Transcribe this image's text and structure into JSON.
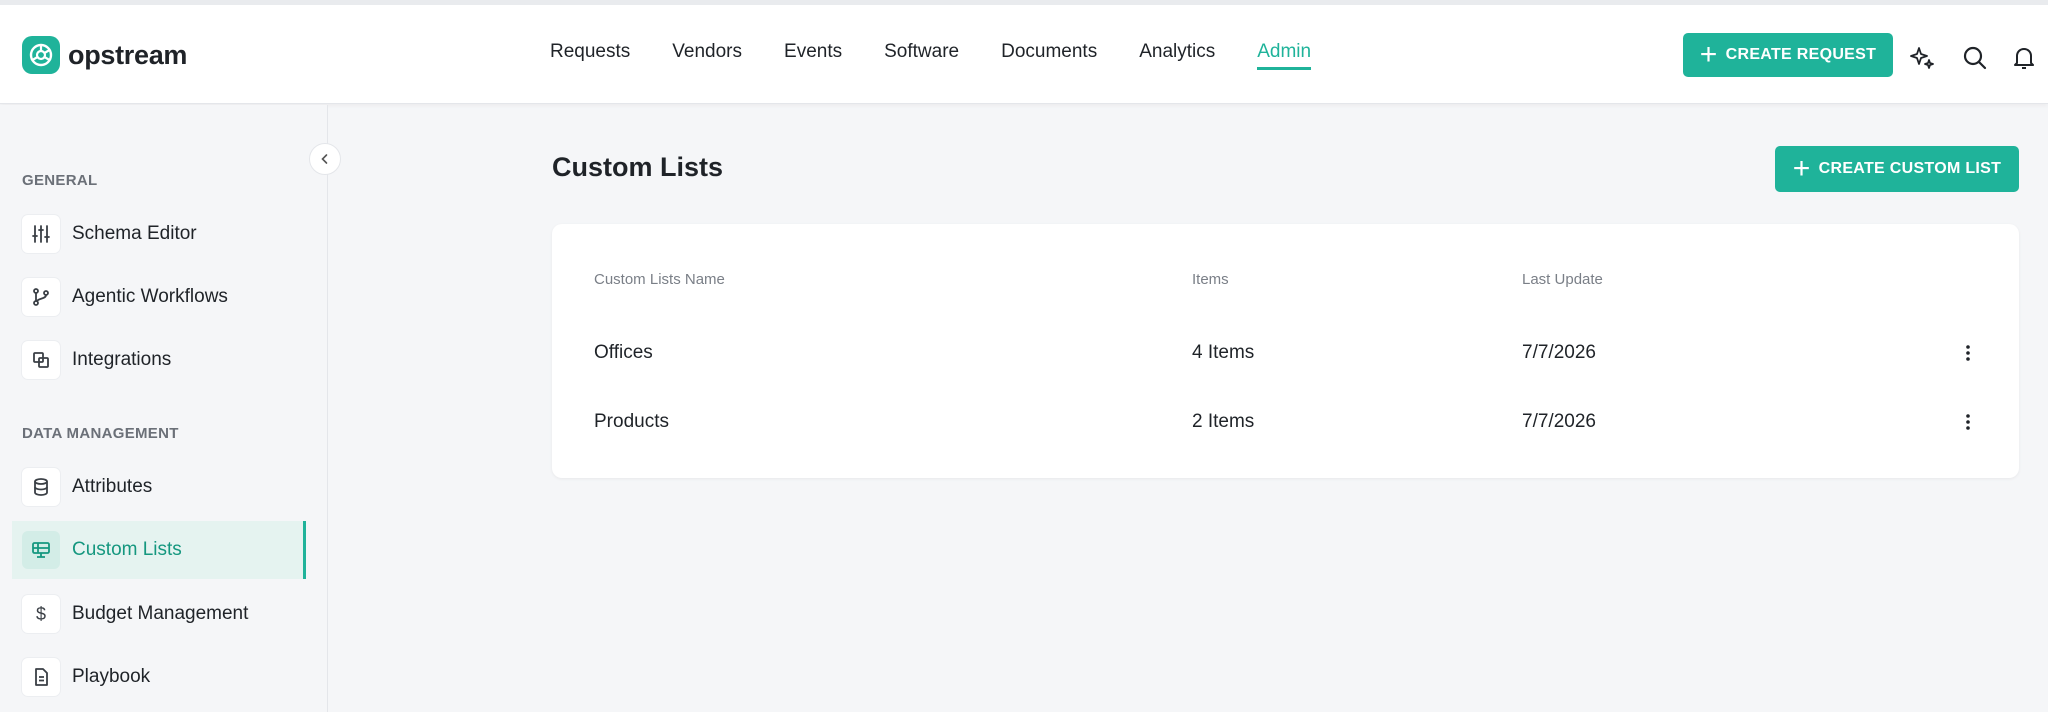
{
  "app": {
    "name": "opstream"
  },
  "nav": {
    "items": [
      {
        "label": "Requests"
      },
      {
        "label": "Vendors"
      },
      {
        "label": "Events"
      },
      {
        "label": "Software"
      },
      {
        "label": "Documents"
      },
      {
        "label": "Analytics"
      },
      {
        "label": "Admin",
        "active": true
      }
    ]
  },
  "header": {
    "create_request_label": "CREATE REQUEST",
    "icons": [
      "sparkle-icon",
      "search-icon",
      "bell-icon"
    ]
  },
  "sidebar": {
    "sections": [
      {
        "label": "GENERAL",
        "items": [
          {
            "label": "Schema Editor",
            "icon": "sliders-icon"
          },
          {
            "label": "Agentic Workflows",
            "icon": "branch-icon"
          },
          {
            "label": "Integrations",
            "icon": "integrations-icon"
          }
        ]
      },
      {
        "label": "DATA MANAGEMENT",
        "items": [
          {
            "label": "Attributes",
            "icon": "database-icon"
          },
          {
            "label": "Custom Lists",
            "icon": "list-icon",
            "active": true
          },
          {
            "label": "Budget Management",
            "icon": "dollar-icon"
          },
          {
            "label": "Playbook",
            "icon": "document-icon"
          }
        ]
      }
    ]
  },
  "main": {
    "title": "Custom Lists",
    "create_label": "CREATE CUSTOM LIST",
    "table": {
      "columns": [
        "Custom Lists Name",
        "Items",
        "Last Update"
      ],
      "rows": [
        {
          "name": "Offices",
          "items": "4 Items",
          "last_update": "7/7/2026"
        },
        {
          "name": "Products",
          "items": "2 Items",
          "last_update": "7/7/2026"
        }
      ]
    }
  },
  "colors": {
    "accent": "#1fb39a",
    "accent_text": "#15977f",
    "active_bg": "#e5f3f0"
  }
}
